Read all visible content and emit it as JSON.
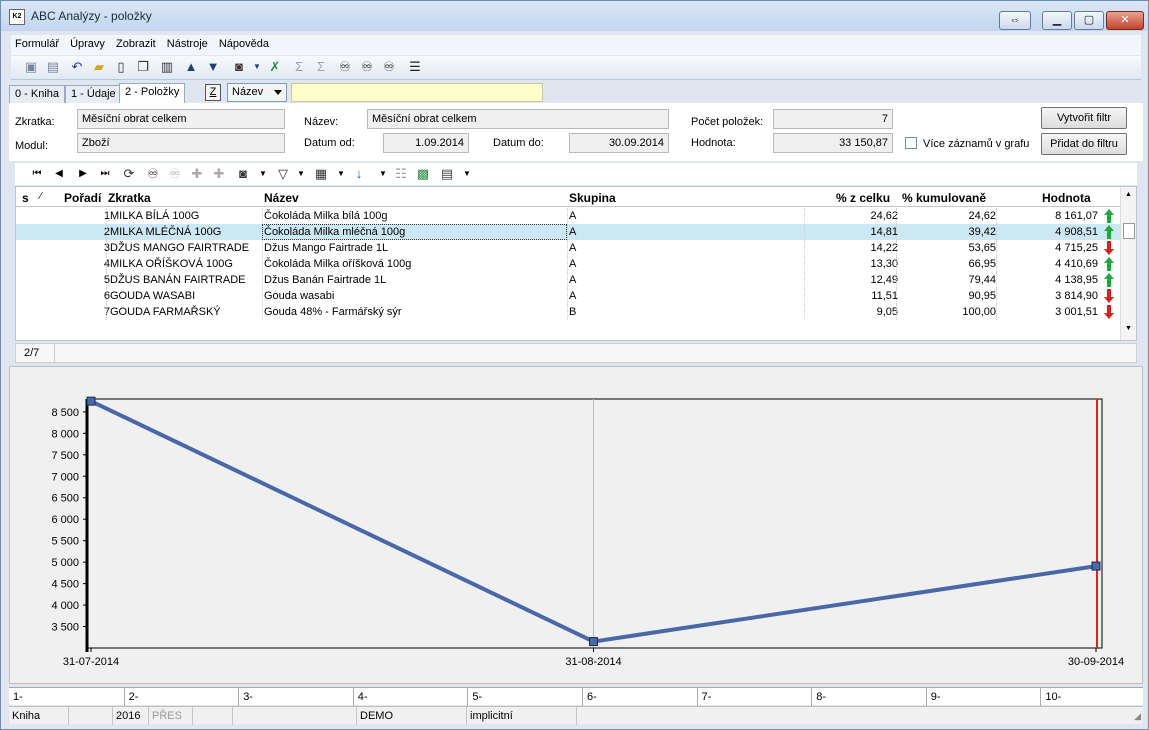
{
  "window": {
    "title": "ABC Analýzy - položky"
  },
  "menu": [
    "Formulář",
    "Úpravy",
    "Zobrazit",
    "Nástroje",
    "Nápověda"
  ],
  "tabs": [
    {
      "label": "0 - Kniha",
      "active": false
    },
    {
      "label": "1 - Údaje",
      "active": false
    },
    {
      "label": "2 - Položky",
      "active": true
    }
  ],
  "sort": {
    "z_label": "Z",
    "field": "Název"
  },
  "header": {
    "zkratka_label": "Zkratka:",
    "zkratka": "Měsíční obrat celkem",
    "modul_label": "Modul:",
    "modul": "Zboží",
    "nazev_label": "Název:",
    "nazev": "Měsíční obrat celkem",
    "datum_od_label": "Datum od:",
    "datum_od": "1.09.2014",
    "datum_do_label": "Datum do:",
    "datum_do": "30.09.2014",
    "pocet_label": "Počet položek:",
    "pocet": "7",
    "hodnota_label": "Hodnota:",
    "hodnota": "33 150,87",
    "vice_label": "Více záznamů v grafu",
    "vytvorit_btn": "Vytvořit filtr",
    "pridat_btn": "Přidat do filtru"
  },
  "grid": {
    "columns": {
      "s": "s",
      "poradi": "Pořadí",
      "zkratka": "Zkratka",
      "nazev": "Název",
      "skupina": "Skupina",
      "pct": "% z celku",
      "kum": "% kumulovaně",
      "hodnota": "Hodnota"
    },
    "rows": [
      {
        "poradi": "1",
        "zkratka": "MILKA BÍLÁ 100G",
        "nazev": "Čokoláda Milka bílá 100g",
        "skupina": "A",
        "pct": "24,62",
        "kum": "24,62",
        "hodnota": "8 161,07",
        "trend": "up"
      },
      {
        "poradi": "2",
        "zkratka": "MILKA MLÉČNÁ 100G",
        "nazev": "Čokoláda Milka mléčná 100g",
        "skupina": "A",
        "pct": "14,81",
        "kum": "39,42",
        "hodnota": "4 908,51",
        "trend": "up"
      },
      {
        "poradi": "3",
        "zkratka": "DŽUS MANGO FAIRTRADE",
        "nazev": "Džus Mango Fairtrade 1L",
        "skupina": "A",
        "pct": "14,22",
        "kum": "53,65",
        "hodnota": "4 715,25",
        "trend": "down"
      },
      {
        "poradi": "4",
        "zkratka": "MILKA OŘÍŠKOVÁ 100G",
        "nazev": "Čokoláda Milka oříšková 100g",
        "skupina": "A",
        "pct": "13,30",
        "kum": "66,95",
        "hodnota": "4 410,69",
        "trend": "up"
      },
      {
        "poradi": "5",
        "zkratka": "DŽUS BANÁN FAIRTRADE",
        "nazev": "Džus Banán Fairtrade 1L",
        "skupina": "A",
        "pct": "12,49",
        "kum": "79,44",
        "hodnota": "4 138,95",
        "trend": "up"
      },
      {
        "poradi": "6",
        "zkratka": "GOUDA WASABI",
        "nazev": "Gouda wasabi",
        "skupina": "A",
        "pct": "11,51",
        "kum": "90,95",
        "hodnota": "3 814,90",
        "trend": "down"
      },
      {
        "poradi": "7",
        "zkratka": "GOUDA FARMAŘSKÝ",
        "nazev": "Gouda 48% - Farmářský sýr",
        "skupina": "B",
        "pct": "9,05",
        "kum": "100,00",
        "hodnota": "3 001,51",
        "trend": "down"
      }
    ],
    "counter": "2/7"
  },
  "chart_data": {
    "type": "line",
    "x": [
      "31-07-2014",
      "31-08-2014",
      "30-09-2014"
    ],
    "series": [
      {
        "values": [
          8750,
          3150,
          4908
        ]
      }
    ],
    "ylim": [
      3000,
      8800
    ],
    "yticks": [
      3500,
      4000,
      4500,
      5000,
      5500,
      6000,
      6500,
      7000,
      7500,
      8000,
      8500
    ],
    "ytick_labels": [
      "3 500",
      "4 000",
      "4 500",
      "5 000",
      "5 500",
      "6 000",
      "6 500",
      "7 000",
      "7 500",
      "8 000",
      "8 500"
    ],
    "line_color": "#4a68a8",
    "marker_line_color": "#e02020"
  },
  "scale": [
    "1-",
    "2-",
    "3-",
    "4-",
    "5-",
    "6-",
    "7-",
    "8-",
    "9-",
    "10-"
  ],
  "status": {
    "kniha": "Kniha",
    "year": "2016",
    "pres": "PŘES",
    "demo": "DEMO",
    "implicit": "implicitní"
  },
  "colors": {
    "up": "#22a83a",
    "down": "#d42020",
    "selected_row": "#cce8f4"
  }
}
